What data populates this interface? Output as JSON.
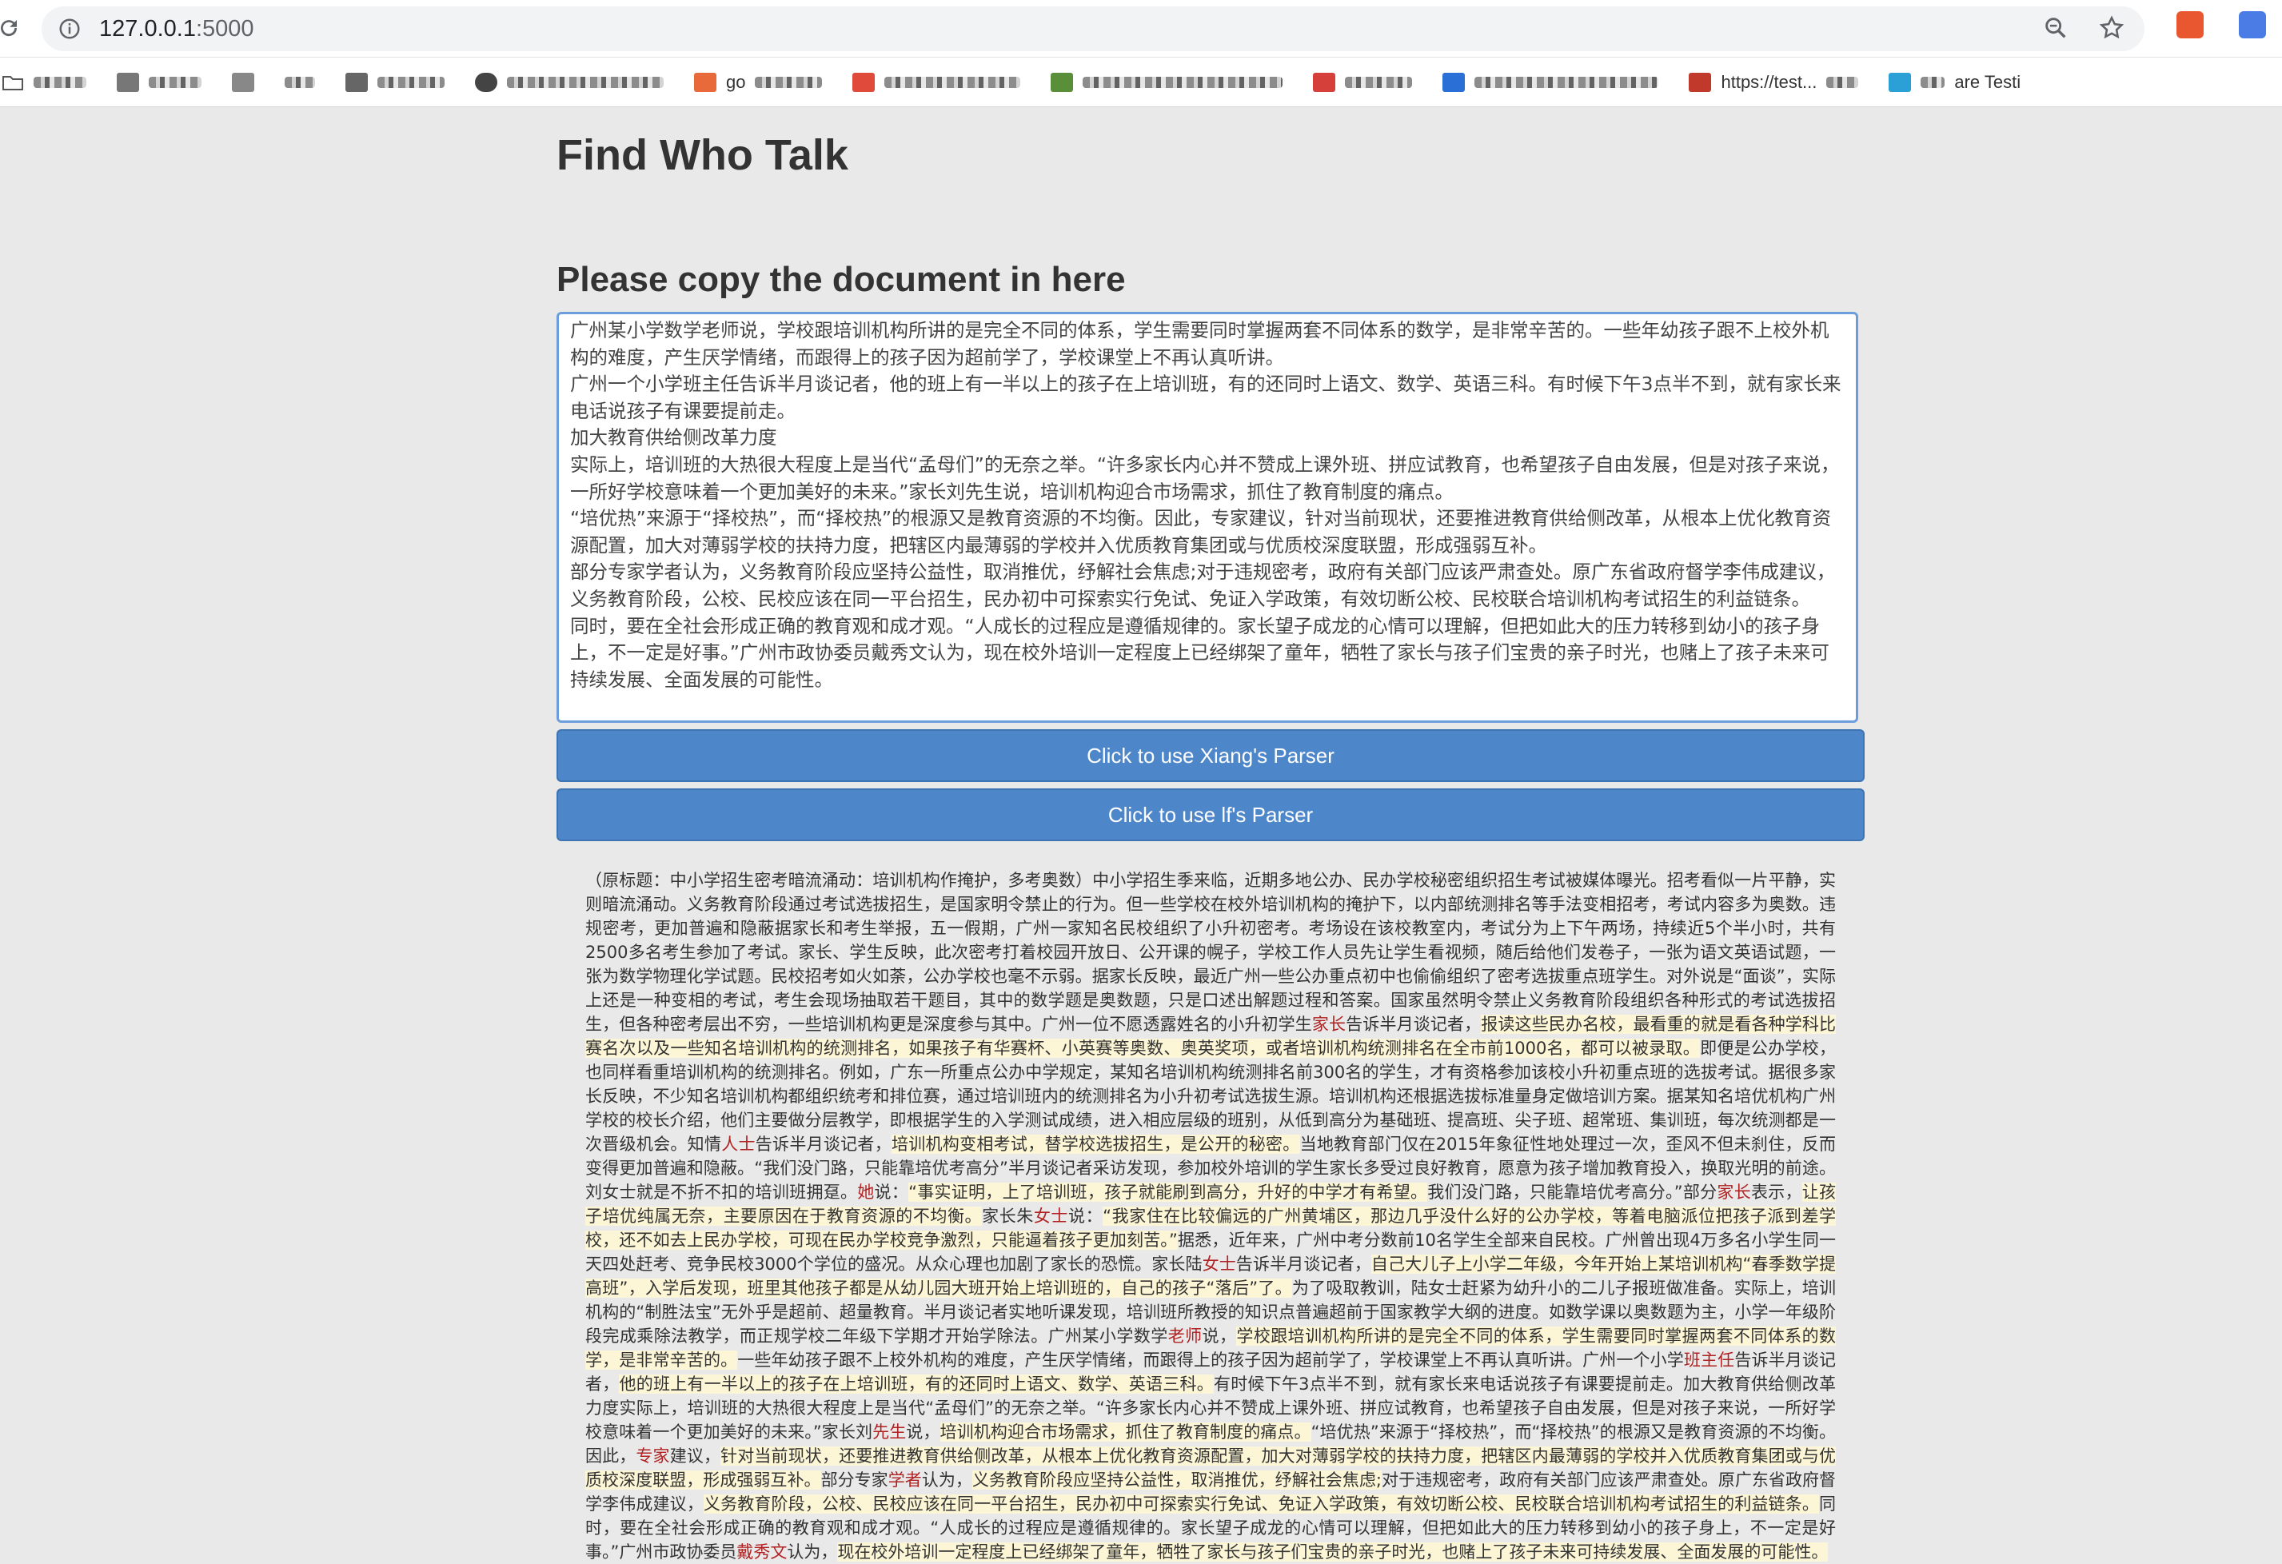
{
  "browser": {
    "url_host": "127.0.0.1",
    "url_port": ":5000",
    "bookmarks": [
      {
        "label": "",
        "icon_color": "#555555"
      },
      {
        "label": "",
        "icon_color": "#777777"
      },
      {
        "label": "",
        "icon_color": "#888888"
      },
      {
        "label": "",
        "icon_color": "#999999"
      },
      {
        "label": "",
        "icon_color": "#666666"
      },
      {
        "label": "",
        "icon_color": "#444444"
      },
      {
        "label": "go",
        "icon_color": "#e86a3a"
      },
      {
        "label": "",
        "icon_color": "#e04a3a"
      },
      {
        "label": "",
        "icon_color": "#5a8f3a"
      },
      {
        "label": "",
        "icon_color": "#d6403a"
      },
      {
        "label": "",
        "icon_color": "#2a6fd6"
      },
      {
        "label": "",
        "icon_color": "#c0392b"
      },
      {
        "label": "https://test...",
        "icon_color": "#d33"
      },
      {
        "label": "are Testi",
        "icon_color": "#2aa0d6"
      }
    ]
  },
  "page": {
    "title": "Find Who Talk",
    "subtitle": "Please copy the document in here",
    "buttons": {
      "xiang": "Click to use Xiang's Parser",
      "lf": "Click to use lf's Parser"
    }
  },
  "document_lines": [
    "广州某小学数学老师说，学校跟培训机构所讲的是完全不同的体系，学生需要同时掌握两套不同体系的数学，是非常辛苦的。一些年幼孩子跟不上校外机构的难度，产生厌学情绪，而跟得上的孩子因为超前学了，学校课堂上不再认真听讲。",
    "广州一个小学班主任告诉半月谈记者，他的班上有一半以上的孩子在上培训班，有的还同时上语文、数学、英语三科。有时候下午3点半不到，就有家长来电话说孩子有课要提前走。",
    "加大教育供给侧改革力度",
    "实际上，培训班的大热很大程度上是当代“孟母们”的无奈之举。“许多家长内心并不赞成上课外班、拼应试教育，也希望孩子自由发展，但是对孩子来说，一所好学校意味着一个更加美好的未来。”家长刘先生说，培训机构迎合市场需求，抓住了教育制度的痛点。",
    "“培优热”来源于“择校热”，而“择校热”的根源又是教育资源的不均衡。因此，专家建议，针对当前现状，还要推进教育供给侧改革，从根本上优化教育资源配置，加大对薄弱学校的扶持力度，把辖区内最薄弱的学校并入优质教育集团或与优质校深度联盟，形成强弱互补。",
    "部分专家学者认为，义务教育阶段应坚持公益性，取消推优，纾解社会焦虑;对于违规密考，政府有关部门应该严肃查处。原广东省政府督学李伟成建议，义务教育阶段，公校、民校应该在同一平台招生，民办初中可探索实行免试、免证入学政策，有效切断公校、民校联合培训机构考试招生的利益链条。",
    "同时，要在全社会形成正确的教育观和成才观。“人成长的过程应是遵循规律的。家长望子成龙的心情可以理解，但把如此大的压力转移到幼小的孩子身上，不一定是好事。”广州市政协委员戴秀文认为，现在校外培训一定程度上已经绑架了童年，牺牲了家长与孩子们宝贵的亲子时光，也赌上了孩子未来可持续发展、全面发展的可能性。"
  ],
  "result": {
    "segments": [
      {
        "t": "（原标题：中小学招生密考暗流涌动：培训机构作掩护，多考奥数）中小学招生季来临，近期多地公办、民办学校秘密组织招生考试被媒体曝光。招考看似一片平静，实则暗流涌动。义务教育阶段通过考试选拔招生，是国家明令禁止的行为。但一些学校在校外培训机构的掩护下，以内部统测排名等手法变相招考，考试内容多为奥数。违规密考，更加普遍和隐蔽据家长和考生举报，五一假期，广州一家知名民校组织了小升初密考。考场设在该校教室内，考试分为上下午两场，持续近5个半小时，共有2500多名考生参加了考试。家长、学生反映，此次密考打着校园开放日、公开课的幌子，学校工作人员先让学生看视频，随后给他们发卷子，一张为语文英语试题，一张为数学物理化学试题。民校招考如火如荼，公办学校也毫不示弱。据家长反映，最近广州一些公办重点初中也偷偷组织了密考选拔重点班学生。对外说是“面谈”，实际上还是一种变相的考试，考生会现场抽取若干题目，其中的数学题是奥数题，只是口述出解题过程和答案。国家虽然明令禁止义务教育阶段组织各种形式的考试选拔招生，但各种密考层出不穷，一些培训机构更是深度参与其中。广州一位不愿透露姓名的小升初学生",
        "k": ""
      },
      {
        "t": "家长",
        "k": "who"
      },
      {
        "t": "告诉半月谈记者，",
        "k": ""
      },
      {
        "t": "报读这些民办名校，最看重的就是看各种学科比赛名次以及一些知名培训机构的统测排名，如果孩子有华赛杯、小英赛等奥数、奥英奖项，或者培训机构统测排名在全市前1000名，都可以被录取。",
        "k": "hl"
      },
      {
        "t": "即便是公办学校，也同样看重培训机构的统测排名。例如，广东一所重点公办中学规定，某知名培训机构统测排名前300名的学生，才有资格参加该校小升初重点班的选拔考试。据很多家长反映，不少知名培训机构都组织统考和排位赛，通过培训班内的统测排名为小升初考试选拔生源。培训机构还根据选拔标准量身定做培训方案。据某知名培优机构广州学校的校长介绍，他们主要做分层教学，即根据学生的入学测试成绩，进入相应层级的班别，从低到高分为基础班、提高班、尖子班、超常班、集训班，每次统测都是一次晋级机会。知情",
        "k": ""
      },
      {
        "t": "人士",
        "k": "who"
      },
      {
        "t": "告诉半月谈记者，",
        "k": ""
      },
      {
        "t": "培训机构变相考试，替学校选拔招生，是公开的秘密。",
        "k": "hl"
      },
      {
        "t": "当地教育部门仅在2015年象征性地处理过一次，歪风不但未刹住，反而变得更加普遍和隐蔽。“我们没门路，只能靠培优考高分”半月谈记者采访发现，参加校外培训的学生家长多受过良好教育，愿意为孩子增加教育投入，换取光明的前途。刘女士就是不折不扣的培训班拥趸。",
        "k": ""
      },
      {
        "t": "她",
        "k": "who"
      },
      {
        "t": "说：",
        "k": ""
      },
      {
        "t": "“事实证明，上了培训班，孩子就能刷到高分，升好的中学才有希望。",
        "k": "hl"
      },
      {
        "t": "我们没门路，只能靠培优考高分。”部分",
        "k": ""
      },
      {
        "t": "家长",
        "k": "who"
      },
      {
        "t": "表示，",
        "k": ""
      },
      {
        "t": "让孩子培优纯属无奈，主要原因在于教育资源的不均衡。",
        "k": "hl"
      },
      {
        "t": "家长朱",
        "k": ""
      },
      {
        "t": "女士",
        "k": "who"
      },
      {
        "t": "说：",
        "k": ""
      },
      {
        "t": "“我家住在比较偏远的广州黄埔区，那边几乎没什么好的公办学校，等着电脑派位把孩子派到差学校，还不如去上民办学校，可现在民办学校竞争激烈，只能逼着孩子更加刻苦。”",
        "k": "hl"
      },
      {
        "t": "据悉，近年来，广州中考分数前10名学生全部来自民校。广州曾出现4万多名小学生同一天四处赶考、竞争民校3000个学位的盛况。从众心理也加剧了家长的恐慌。家长陆",
        "k": ""
      },
      {
        "t": "女士",
        "k": "who"
      },
      {
        "t": "告诉半月谈记者，",
        "k": ""
      },
      {
        "t": "自己大儿子上小学二年级，今年开始上某培训机构“春季数学提高班”，入学后发现，班里其他孩子都是从幼儿园大班开始上培训班的，自己的孩子“落后”了。",
        "k": "hl"
      },
      {
        "t": "为了吸取教训，陆女士赶紧为幼升小的二儿子报班做准备。实际上，培训机构的“制胜法宝”无外乎是超前、超量教育。半月谈记者实地听课发现，培训班所教授的知识点普遍超前于国家教学大纲的进度。如数学课以奥数题为主，小学一年级阶段完成乘除法教学，而正规学校二年级下学期才开始学除法。广州某小学数学",
        "k": ""
      },
      {
        "t": "老师",
        "k": "who"
      },
      {
        "t": "说，",
        "k": ""
      },
      {
        "t": "学校跟培训机构所讲的是完全不同的体系，学生需要同时掌握两套不同体系的数学，是非常辛苦的。",
        "k": "hl"
      },
      {
        "t": "一些年幼孩子跟不上校外机构的难度，产生厌学情绪，而跟得上的孩子因为超前学了，学校课堂上不再认真听讲。广州一个小学",
        "k": ""
      },
      {
        "t": "班主任",
        "k": "who"
      },
      {
        "t": "告诉半月谈记者，",
        "k": ""
      },
      {
        "t": "他的班上有一半以上的孩子在上培训班，有的还同时上语文、数学、英语三科。",
        "k": "hl"
      },
      {
        "t": "有时候下午3点半不到，就有家长来电话说孩子有课要提前走。加大教育供给侧改革力度实际上，培训班的大热很大程度上是当代“孟母们”的无奈之举。“许多家长内心并不赞成上课外班、拼应试教育，也希望孩子自由发展，但是对孩子来说，一所好学校意味着一个更加美好的未来。”家长刘",
        "k": ""
      },
      {
        "t": "先生",
        "k": "who"
      },
      {
        "t": "说，",
        "k": ""
      },
      {
        "t": "培训机构迎合市场需求，抓住了教育制度的痛点。",
        "k": "hl"
      },
      {
        "t": "“培优热”来源于“择校热”，而“择校热”的根源又是教育资源的不均衡。因此，",
        "k": ""
      },
      {
        "t": "专家",
        "k": "who"
      },
      {
        "t": "建议，",
        "k": ""
      },
      {
        "t": "针对当前现状，还要推进教育供给侧改革，从根本上优化教育资源配置，加大对薄弱学校的扶持力度，把辖区内最薄弱的学校并入优质教育集团或与优质校深度联盟，形成强弱互补。",
        "k": "hl"
      },
      {
        "t": "部分专家",
        "k": ""
      },
      {
        "t": "学者",
        "k": "who"
      },
      {
        "t": "认为，",
        "k": ""
      },
      {
        "t": "义务教育阶段应坚持公益性，取消推优，纾解社会焦虑;",
        "k": "hl"
      },
      {
        "t": "对于违规密考，政府有关部门应该严肃查处。原广东省政府督学李伟成建议，",
        "k": ""
      },
      {
        "t": "义务教育阶段，公校、民校应该在同一平台招生，民办初中可探索实行免试、免证入学政策，有效切断公校、民校联合培训机构考试招生的利益链条。",
        "k": "hl"
      },
      {
        "t": "同时，要在全社会形成正确的教育观和成才观。“人成长的过程应是遵循规律的。家长望子成龙的心情可以理解，但把如此大的压力转移到幼小的孩子身上，不一定是好事。”广州市政协委员",
        "k": ""
      },
      {
        "t": "戴秀文",
        "k": "who"
      },
      {
        "t": "认为，",
        "k": ""
      },
      {
        "t": "现在校外培训一定程度上已经绑架了童年，牺牲了家长与孩子们宝贵的亲子时光，也赌上了孩子未来可持续发展、全面发展的可能性。",
        "k": "hl"
      }
    ]
  },
  "colors": {
    "button_bg": "#4e87c9",
    "textarea_border": "#6d9edb",
    "speaker": "#b02222",
    "highlight": "#fdf6d6"
  }
}
